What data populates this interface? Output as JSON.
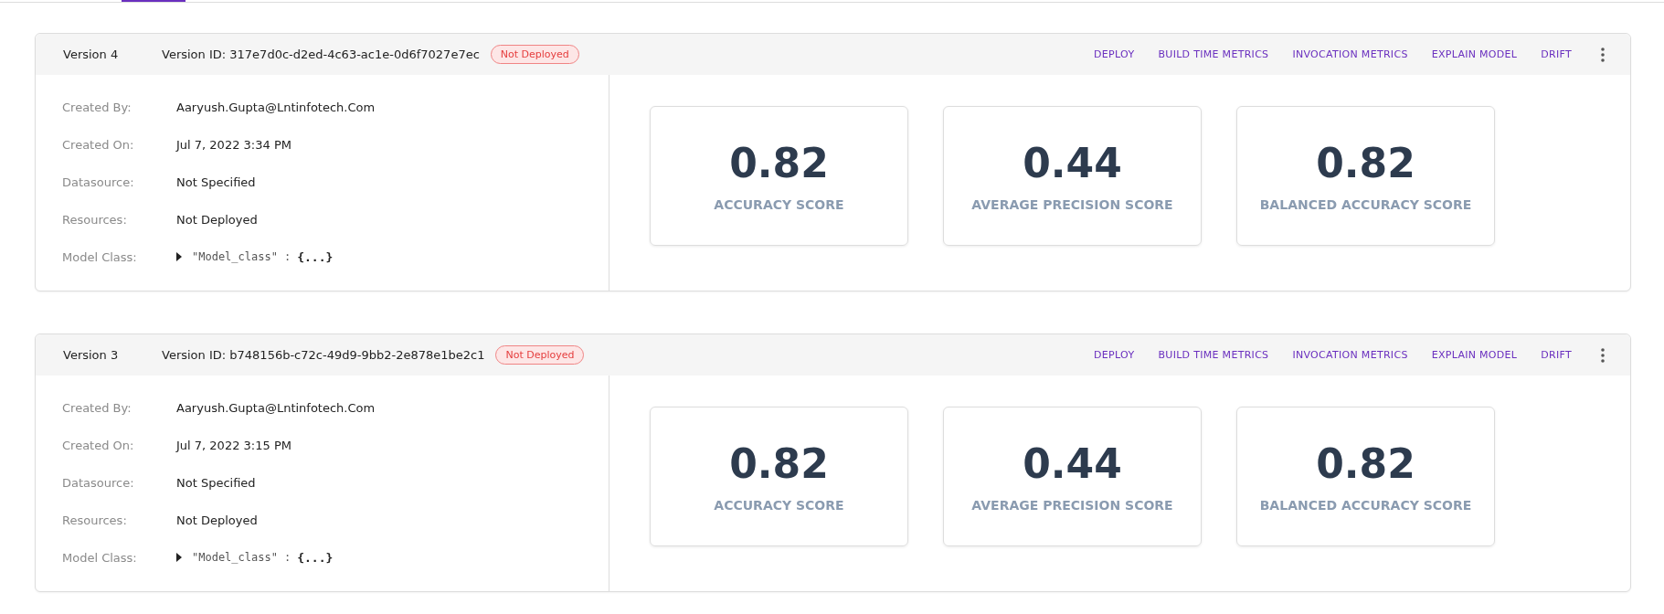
{
  "versions": [
    {
      "title": "Version 4",
      "version_id": "Version ID: 317e7d0c-d2ed-4c63-ac1e-0d6f7027e7ec",
      "status": "Not Deployed",
      "deployed": false,
      "actions": [
        "DEPLOY",
        "BUILD TIME METRICS",
        "INVOCATION METRICS",
        "EXPLAIN MODEL",
        "DRIFT"
      ],
      "details": [
        {
          "label": "Created By:",
          "value": "Aaryush.Gupta@Lntinfotech.Com"
        },
        {
          "label": "Created On:",
          "value": "Jul 7, 2022 3:34 PM"
        },
        {
          "label": "Datasource:",
          "value": "Not Specified"
        },
        {
          "label": "Resources:",
          "value": "Not Deployed"
        }
      ],
      "model_class": {
        "label": "Model Class:",
        "key": "\"Model_class\"",
        "separator": ":",
        "value": "{...}",
        "expanded": false
      },
      "metrics": [
        {
          "value": "0.82",
          "label": "ACCURACY SCORE"
        },
        {
          "value": "0.44",
          "label": "AVERAGE PRECISION SCORE"
        },
        {
          "value": "0.82",
          "label": "BALANCED ACCURACY SCORE"
        }
      ]
    },
    {
      "title": "Version 3",
      "version_id": "Version ID: b748156b-c72c-49d9-9bb2-2e878e1be2c1",
      "status": "Not Deployed",
      "deployed": false,
      "actions": [
        "DEPLOY",
        "BUILD TIME METRICS",
        "INVOCATION METRICS",
        "EXPLAIN MODEL",
        "DRIFT"
      ],
      "details": [
        {
          "label": "Created By:",
          "value": "Aaryush.Gupta@Lntinfotech.Com"
        },
        {
          "label": "Created On:",
          "value": "Jul 7, 2022 3:15 PM"
        },
        {
          "label": "Datasource:",
          "value": "Not Specified"
        },
        {
          "label": "Resources:",
          "value": "Not Deployed"
        }
      ],
      "model_class": {
        "label": "Model Class:",
        "key": "\"Model_class\"",
        "separator": ":",
        "value": "{...}",
        "expanded": false
      },
      "metrics": [
        {
          "value": "0.82",
          "label": "ACCURACY SCORE"
        },
        {
          "value": "0.44",
          "label": "AVERAGE PRECISION SCORE"
        },
        {
          "value": "0.82",
          "label": "BALANCED ACCURACY SCORE"
        }
      ]
    }
  ]
}
